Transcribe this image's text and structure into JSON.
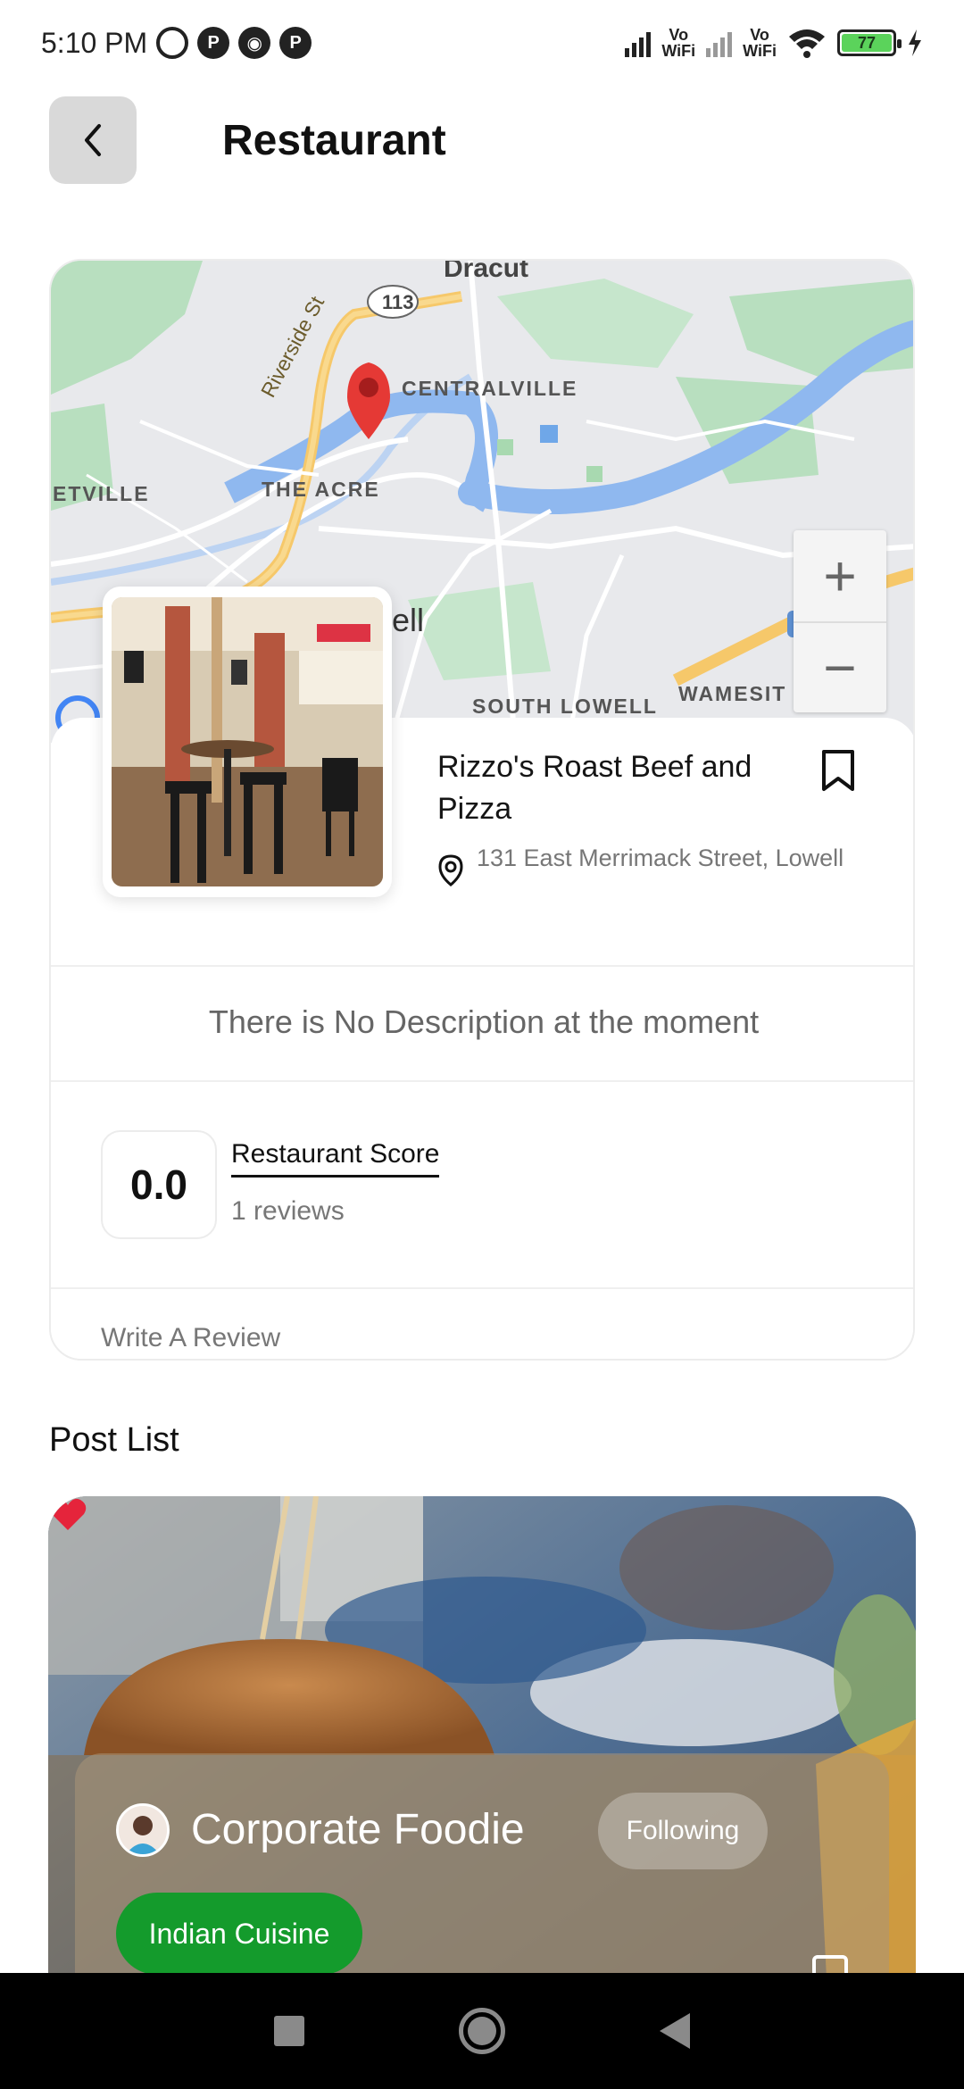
{
  "status_bar": {
    "time": "5:10 PM",
    "battery_level": "77",
    "vo_wifi_label_1": "Vo\nWiFi",
    "vo_wifi_label_2": "Vo\nWiFi"
  },
  "header": {
    "title": "Restaurant"
  },
  "map": {
    "labels": {
      "dracut": "Dracut",
      "route": "113",
      "centralville": "CENTRALVILLE",
      "riverside": "Riverside St",
      "the_acre": "THE ACRE",
      "etville": "ETVILLE",
      "ell": "ell",
      "south_lowell": "SOUTH LOWELL",
      "wamesit": "WAMESIT",
      "interstate": "495"
    },
    "zoom_in": "+",
    "zoom_out": "−"
  },
  "restaurant": {
    "name": "Rizzo's Roast Beef and Pizza",
    "address": "131 East Merrimack Street, Lowell",
    "description": "There is No Description at the moment",
    "score": "0.0",
    "score_label": "Restaurant Score",
    "reviews": "1 reviews",
    "write_review": "Write A Review"
  },
  "post_list": {
    "title": "Post List",
    "posts": [
      {
        "author": "Corporate Foodie",
        "follow_label": "Following",
        "tag": "Indian Cuisine"
      }
    ]
  },
  "colors": {
    "tag_green": "#149b2c",
    "pin_red": "#e53935",
    "heart_red": "#e5243b"
  }
}
